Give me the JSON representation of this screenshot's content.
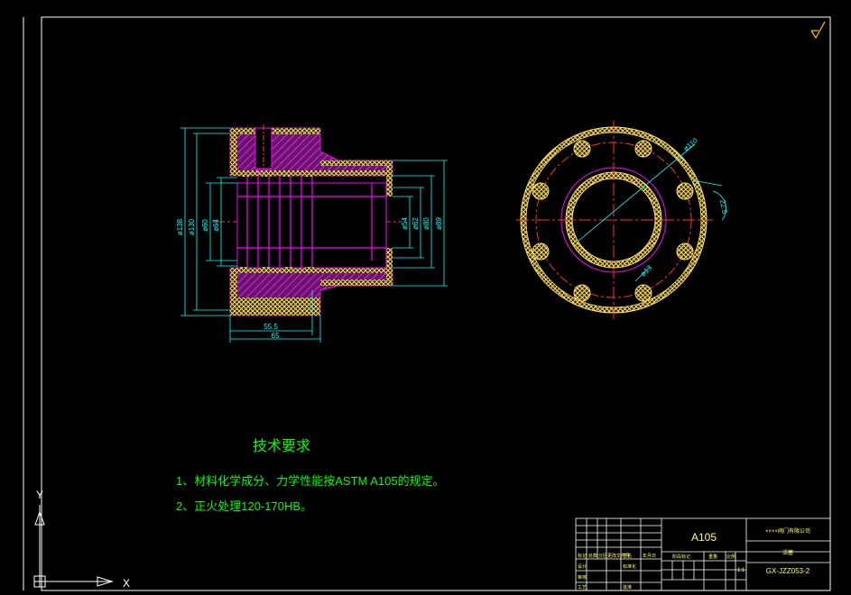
{
  "colors": {
    "background": "#000000",
    "border": "#ffffff",
    "dimension": "#00ffff",
    "hatch": "#ff00ff",
    "hatch_fill": "#7a1a7a",
    "knurl": "#ffe066",
    "centerline": "#ff3030",
    "text": "#00ff00",
    "titleblock": "#ffffff",
    "accent": "#ffcc00"
  },
  "drawing": {
    "section_view": {
      "dimensions": {
        "d_outer": "ø138",
        "d_130": "ø130",
        "d_60": "ø60",
        "d_64": "ø64",
        "d_54": "ø54",
        "d_62": "ø62",
        "d_80": "ø80",
        "d_89": "ø89",
        "len_555": "55.5",
        "len_65": "65"
      }
    },
    "end_view": {
      "dimensions": {
        "pcd": "ø110",
        "angle": "22.5",
        "hole": "ø13"
      }
    }
  },
  "notes": {
    "title": "技术要求",
    "items": [
      "1、材料化学成分、力学性能按ASTM  A105的规定。",
      "2、正火处理120-170HB。"
    ]
  },
  "title_block": {
    "material": "A105",
    "company": "××××阀门有限公司",
    "part_name": "活塞",
    "drawing_no": "GX-JZZ053-2",
    "scale": "1:1",
    "labels": {
      "mark": "标记",
      "count": "处数",
      "zone": "分区",
      "change_doc": "更改文件号",
      "sign": "签名",
      "date": "年月日",
      "designer": "设计",
      "standardize": "标准化",
      "review": "审核",
      "process": "工艺",
      "approve": "批准",
      "stage_mark": "阶段标记",
      "weight": "重量",
      "scale_label": "比例"
    }
  },
  "cursor": {
    "x_label": "X",
    "y_label": "Y"
  }
}
